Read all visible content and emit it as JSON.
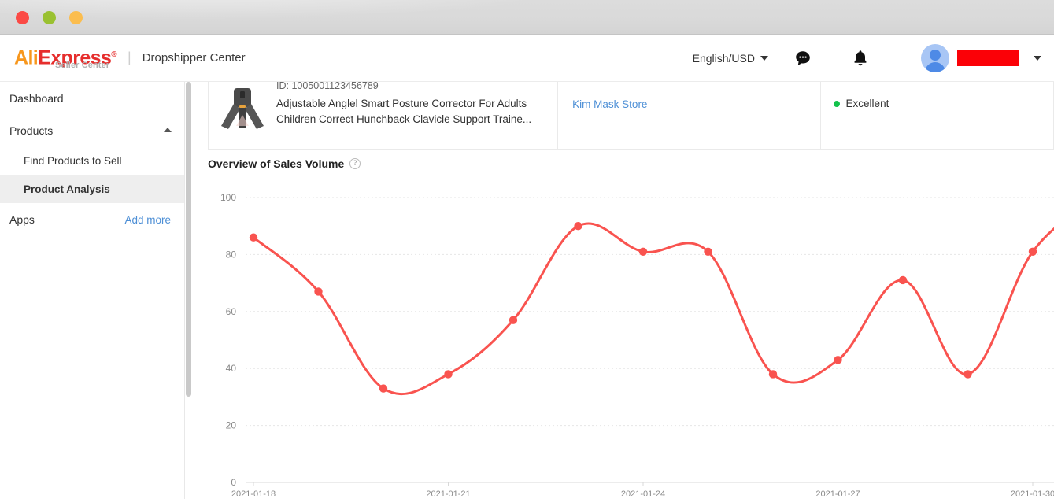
{
  "window": {
    "traffic_lights": [
      "close",
      "minimize",
      "maximize"
    ]
  },
  "header": {
    "logo_ali": "Ali",
    "logo_l": "",
    "logo_express": "Express",
    "logo_tm": "®",
    "logo_sub": "Seller Center",
    "divider": "|",
    "title": "Dropshipper Center",
    "language": "English/USD",
    "chat_icon": "chat-bubble-icon",
    "bell_icon": "notification-bell-icon",
    "avatar": "user-avatar",
    "username": "",
    "user_caret": "chevron-down-icon"
  },
  "sidebar": {
    "items": [
      {
        "label": "Dashboard",
        "type": "top",
        "expandable": false
      },
      {
        "label": "Products",
        "type": "top",
        "expandable": true,
        "expanded": true
      },
      {
        "label": "Find Products to Sell",
        "type": "sub",
        "active": false
      },
      {
        "label": "Product Analysis",
        "type": "sub",
        "active": true
      }
    ],
    "apps_label": "Apps",
    "add_more_label": "Add more"
  },
  "product_row": {
    "product_id": "ID: 1005001123456789",
    "product_name": "Adjustable Anglel Smart Posture Corrector For Adults Children Correct Hunchback Clavicle Support Traine...",
    "store_name": "Kim Mask Store",
    "rating_label": "Excellent",
    "rating_color": "#13c24b"
  },
  "chart_card": {
    "title": "Overview of Sales Volume",
    "help_icon": "?"
  },
  "chart_data": {
    "type": "line",
    "title": "Overview of Sales Volume",
    "xlabel": "",
    "ylabel": "",
    "ylim": [
      0,
      100
    ],
    "yticks": [
      0,
      20,
      40,
      60,
      80,
      100
    ],
    "grid": true,
    "legend": false,
    "line_color": "#f9534f",
    "point_color": "#f9534f",
    "smooth": true,
    "xtick_labels": [
      "2021-01-18",
      "2021-01-21",
      "2021-01-24",
      "2021-01-27",
      "2021-01-30"
    ],
    "xtick_indices": [
      0,
      3,
      6,
      9,
      12
    ],
    "x": [
      "2021-01-18",
      "2021-01-19",
      "2021-01-20",
      "2021-01-21",
      "2021-01-22",
      "2021-01-23",
      "2021-01-24",
      "2021-01-25",
      "2021-01-26",
      "2021-01-27",
      "2021-01-28",
      "2021-01-29",
      "2021-01-30"
    ],
    "values": [
      86,
      67,
      33,
      38,
      57,
      90,
      81,
      81,
      38,
      43,
      71,
      38,
      81
    ],
    "note": "Series continues beyond the right edge of the visible viewport"
  }
}
